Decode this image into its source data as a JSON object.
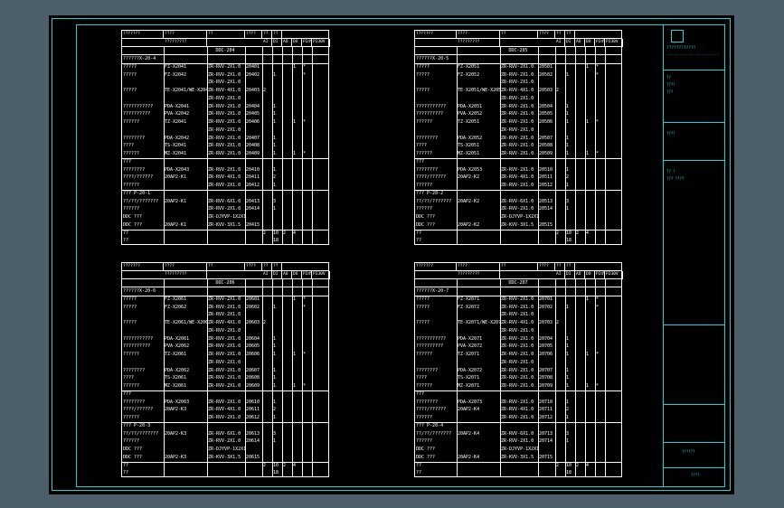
{
  "header": {
    "h0": "???????",
    "h1": "????",
    "h1b": "?????????",
    "h2": "??",
    "h3": "????",
    "h4": "??",
    "h5": "??",
    "io": [
      "AI",
      "DI",
      "AO",
      "DO",
      "P24V",
      "P230V"
    ]
  },
  "tables": [
    {
      "ddc": "DDC-204",
      "rows": [
        [
          "??????X-20-4",
          "",
          "",
          "",
          "",
          "",
          "",
          "",
          ""
        ],
        [
          "?????",
          "FZ-X2041",
          "ZR-RVV-2X1.0",
          "20401",
          "",
          "",
          "",
          "1",
          "*"
        ],
        [
          "?????",
          "FZ-X2042",
          "ZR-RVV-2X1.0",
          "20402",
          "",
          "1",
          "",
          "",
          "*"
        ],
        [
          "",
          "",
          "ZR-RVV-2X1.0",
          "",
          "",
          "",
          "",
          "",
          ""
        ],
        [
          "?????",
          "TE-X2041/WE-X2041",
          "ZR-RVV-4X1.0",
          "20403",
          "2",
          "",
          "",
          "",
          ""
        ],
        [
          "",
          "",
          "ZR-RVV-2X1.0",
          "",
          "",
          "",
          "",
          "",
          ""
        ],
        [
          "???????????",
          "PDA-X2041",
          "ZR-RVV-2X1.0",
          "20404",
          "",
          "1",
          "",
          "",
          ""
        ],
        [
          "??????????",
          "PVA-X2042",
          "ZR-RVV-2X1.0",
          "20405",
          "",
          "1",
          "",
          "",
          ""
        ],
        [
          "??????",
          "TZ-X2041",
          "ZR-RVV-2X1.0",
          "20406",
          "",
          "1",
          "",
          "1",
          "*"
        ],
        [
          "",
          "",
          "ZR-RVV-2X1.0",
          "",
          "",
          "",
          "",
          "",
          ""
        ],
        [
          "????????",
          "PDA-X2042",
          "ZR-RVV-2X1.0",
          "20407",
          "",
          "1",
          "",
          "",
          ""
        ],
        [
          "????",
          "TS-X2041",
          "ZR-RVV-2X1.0",
          "20408",
          "",
          "1",
          "",
          "",
          ""
        ],
        [
          "??????",
          "MZ-X2041",
          "ZR-RVV-2X1.0",
          "20409",
          "",
          "1",
          "",
          "1",
          "*"
        ],
        [
          "???",
          "",
          "",
          "",
          "",
          "",
          "",
          "",
          ""
        ],
        [
          "????????",
          "PDA-X2043",
          "ZR-RVV-2X1.0",
          "20410",
          "",
          "1",
          "",
          "",
          ""
        ],
        [
          "????/??????",
          "20AP2-K1",
          "ZR-RVV-4X1.0",
          "20411",
          "",
          "2",
          "",
          "",
          ""
        ],
        [
          "??????",
          "",
          "ZR-RVV-2X1.0",
          "20412",
          "",
          "1",
          "",
          "",
          ""
        ],
        [
          "??? P-20-1",
          "",
          "",
          "",
          "",
          "",
          "",
          "",
          ""
        ],
        [
          "??/??/???????",
          "20AP2-K1",
          "ZR-RVV-6X1.0",
          "20413",
          "",
          "3",
          "",
          "",
          ""
        ],
        [
          "??????",
          "",
          "ZR-RVV-2X1.0",
          "20414",
          "",
          "1",
          "",
          "",
          ""
        ],
        [
          "DDC ???",
          "",
          "ZR-DJYVP-1X2X1.0",
          "",
          "",
          "",
          "",
          "",
          ""
        ],
        [
          "DDC ???",
          "20AP2-K1",
          "ZR-KVV-3X1.5",
          "20415",
          "",
          "",
          "",
          "",
          ""
        ],
        [
          "??",
          "",
          "",
          "",
          "2",
          "10",
          "2",
          "4",
          ""
        ],
        [
          "??",
          "",
          "",
          "",
          "",
          "18",
          "",
          "",
          ""
        ]
      ]
    },
    {
      "ddc": "DDC-205",
      "rows": [
        [
          "??????X-20-5",
          "",
          "",
          "",
          "",
          "",
          "",
          "",
          ""
        ],
        [
          "?????",
          "FZ-X2051",
          "ZR-RVV-2X1.0",
          "20501",
          "",
          "",
          "",
          "1",
          "*"
        ],
        [
          "?????",
          "FZ-X2052",
          "ZR-RVV-2X1.0",
          "20502",
          "",
          "1",
          "",
          "",
          "*"
        ],
        [
          "",
          "",
          "ZR-RVV-2X1.0",
          "",
          "",
          "",
          "",
          "",
          ""
        ],
        [
          "?????",
          "TE-X2051/WE-X2051",
          "ZR-RVV-4X1.0",
          "20503",
          "2",
          "",
          "",
          "",
          ""
        ],
        [
          "",
          "",
          "ZR-RVV-2X1.0",
          "",
          "",
          "",
          "",
          "",
          ""
        ],
        [
          "???????????",
          "PDA-X2051",
          "ZR-RVV-2X1.0",
          "20504",
          "",
          "1",
          "",
          "",
          ""
        ],
        [
          "??????????",
          "PVA-X2052",
          "ZR-RVV-2X1.0",
          "20505",
          "",
          "1",
          "",
          "",
          ""
        ],
        [
          "??????",
          "TZ-X2051",
          "ZR-RVV-2X1.0",
          "20506",
          "",
          "1",
          "",
          "1",
          "*"
        ],
        [
          "",
          "",
          "ZR-RVV-2X1.0",
          "",
          "",
          "",
          "",
          "",
          ""
        ],
        [
          "????????",
          "PDA-X2052",
          "ZR-RVV-2X1.0",
          "20507",
          "",
          "1",
          "",
          "",
          ""
        ],
        [
          "????",
          "TS-X2051",
          "ZR-RVV-2X1.0",
          "20508",
          "",
          "1",
          "",
          "",
          ""
        ],
        [
          "??????",
          "MZ-X2051",
          "ZR-RVV-2X1.0",
          "20509",
          "",
          "1",
          "",
          "1",
          "*"
        ],
        [
          "???",
          "",
          "",
          "",
          "",
          "",
          "",
          "",
          ""
        ],
        [
          "????????",
          "PDA-X2053",
          "ZR-RVV-2X1.0",
          "20510",
          "",
          "1",
          "",
          "",
          ""
        ],
        [
          "????/??????",
          "20AP2-K2",
          "ZR-RVV-4X1.0",
          "20511",
          "",
          "2",
          "",
          "",
          ""
        ],
        [
          "??????",
          "",
          "ZR-RVV-2X1.0",
          "20512",
          "",
          "1",
          "",
          "",
          ""
        ],
        [
          "??? P-20-2",
          "",
          "",
          "",
          "",
          "",
          "",
          "",
          ""
        ],
        [
          "??/??/???????",
          "20AP2-K2",
          "ZR-RVV-6X1.0",
          "20513",
          "",
          "3",
          "",
          "",
          ""
        ],
        [
          "??????",
          "",
          "ZR-RVV-2X1.0",
          "20514",
          "",
          "1",
          "",
          "",
          ""
        ],
        [
          "DDC ???",
          "",
          "ZR-DJYVP-1X2X1.0",
          "",
          "",
          "",
          "",
          "",
          ""
        ],
        [
          "DDC ???",
          "20AP2-K2",
          "ZR-KVV-3X1.5",
          "20515",
          "",
          "",
          "",
          "",
          ""
        ],
        [
          "??",
          "",
          "",
          "",
          "2",
          "10",
          "2",
          "4",
          ""
        ],
        [
          "??",
          "",
          "",
          "",
          "",
          "18",
          "",
          "",
          ""
        ]
      ]
    },
    {
      "ddc": "DDC-206",
      "rows": [
        [
          "??????X-20-6",
          "",
          "",
          "",
          "",
          "",
          "",
          "",
          ""
        ],
        [
          "?????",
          "FZ-X2061",
          "ZR-RVV-2X1.0",
          "20601",
          "",
          "",
          "",
          "1",
          "*"
        ],
        [
          "?????",
          "FZ-X2062",
          "ZR-RVV-2X1.0",
          "20602",
          "",
          "1",
          "",
          "",
          "*"
        ],
        [
          "",
          "",
          "ZR-RVV-2X1.0",
          "",
          "",
          "",
          "",
          "",
          ""
        ],
        [
          "?????",
          "TE-X2061/WE-X2061",
          "ZR-RVV-4X1.0",
          "20603",
          "2",
          "",
          "",
          "",
          ""
        ],
        [
          "",
          "",
          "ZR-RVV-2X1.0",
          "",
          "",
          "",
          "",
          "",
          ""
        ],
        [
          "???????????",
          "PDA-X2061",
          "ZR-RVV-2X1.0",
          "20604",
          "",
          "1",
          "",
          "",
          ""
        ],
        [
          "??????????",
          "PVA-X2062",
          "ZR-RVV-2X1.0",
          "20605",
          "",
          "1",
          "",
          "",
          ""
        ],
        [
          "??????",
          "TZ-X2061",
          "ZR-RVV-2X1.0",
          "20606",
          "",
          "1",
          "",
          "1",
          "*"
        ],
        [
          "",
          "",
          "ZR-RVV-2X1.0",
          "",
          "",
          "",
          "",
          "",
          ""
        ],
        [
          "????????",
          "PDA-X2062",
          "ZR-RVV-2X1.0",
          "20607",
          "",
          "1",
          "",
          "",
          ""
        ],
        [
          "????",
          "TS-X2061",
          "ZR-RVV-2X1.0",
          "20608",
          "",
          "1",
          "",
          "",
          ""
        ],
        [
          "??????",
          "MZ-X2061",
          "ZR-RVV-2X1.0",
          "20609",
          "",
          "1",
          "",
          "1",
          "*"
        ],
        [
          "???",
          "",
          "",
          "",
          "",
          "",
          "",
          "",
          ""
        ],
        [
          "????????",
          "PDA-X2063",
          "ZR-RVV-2X1.0",
          "20610",
          "",
          "1",
          "",
          "",
          ""
        ],
        [
          "????/??????",
          "20AP2-K3",
          "ZR-RVV-4X1.0",
          "20611",
          "",
          "2",
          "",
          "",
          ""
        ],
        [
          "??????",
          "",
          "ZR-RVV-2X1.0",
          "20612",
          "",
          "1",
          "",
          "",
          ""
        ],
        [
          "??? P-20-3",
          "",
          "",
          "",
          "",
          "",
          "",
          "",
          ""
        ],
        [
          "??/??/???????",
          "20AP2-K3",
          "ZR-RVV-6X1.0",
          "20613",
          "",
          "3",
          "",
          "",
          ""
        ],
        [
          "??????",
          "",
          "ZR-RVV-2X1.0",
          "20614",
          "",
          "1",
          "",
          "",
          ""
        ],
        [
          "DDC ???",
          "",
          "ZR-DJYVP-1X2X1.0",
          "",
          "",
          "",
          "",
          "",
          ""
        ],
        [
          "DDC ???",
          "20AP2-K3",
          "ZR-KVV-3X1.5",
          "20615",
          "",
          "",
          "",
          "",
          ""
        ],
        [
          "??",
          "",
          "",
          "",
          "2",
          "10",
          "2",
          "4",
          ""
        ],
        [
          "??",
          "",
          "",
          "",
          "",
          "18",
          "",
          "",
          ""
        ]
      ]
    },
    {
      "ddc": "DDC-207",
      "rows": [
        [
          "??????X-20-7",
          "",
          "",
          "",
          "",
          "",
          "",
          "",
          ""
        ],
        [
          "?????",
          "FZ-X2071",
          "ZR-RVV-2X1.0",
          "20701",
          "",
          "",
          "",
          "1",
          "*"
        ],
        [
          "?????",
          "FZ-X2072",
          "ZR-RVV-2X1.0",
          "20702",
          "",
          "1",
          "",
          "",
          "*"
        ],
        [
          "",
          "",
          "ZR-RVV-2X1.0",
          "",
          "",
          "",
          "",
          "",
          ""
        ],
        [
          "?????",
          "TE-X2071/WE-X2071",
          "ZR-RVV-4X1.0",
          "20703",
          "2",
          "",
          "",
          "",
          ""
        ],
        [
          "",
          "",
          "ZR-RVV-2X1.0",
          "",
          "",
          "",
          "",
          "",
          ""
        ],
        [
          "???????????",
          "PDA-X2071",
          "ZR-RVV-2X1.0",
          "20704",
          "",
          "1",
          "",
          "",
          ""
        ],
        [
          "??????????",
          "PVA-X2072",
          "ZR-RVV-2X1.0",
          "20705",
          "",
          "1",
          "",
          "",
          ""
        ],
        [
          "??????",
          "TZ-X2071",
          "ZR-RVV-2X1.0",
          "20706",
          "",
          "1",
          "",
          "1",
          "*"
        ],
        [
          "",
          "",
          "ZR-RVV-2X1.0",
          "",
          "",
          "",
          "",
          "",
          ""
        ],
        [
          "????????",
          "PDA-X2072",
          "ZR-RVV-2X1.0",
          "20707",
          "",
          "1",
          "",
          "",
          ""
        ],
        [
          "????",
          "TS-X2071",
          "ZR-RVV-2X1.0",
          "20708",
          "",
          "1",
          "",
          "",
          ""
        ],
        [
          "??????",
          "MZ-X2071",
          "ZR-RVV-2X1.0",
          "20709",
          "",
          "1",
          "",
          "1",
          "*"
        ],
        [
          "???",
          "",
          "",
          "",
          "",
          "",
          "",
          "",
          ""
        ],
        [
          "????????",
          "PDA-X2073",
          "ZR-RVV-2X1.0",
          "20710",
          "",
          "1",
          "",
          "",
          ""
        ],
        [
          "????/??????",
          "20AP2-K4",
          "ZR-RVV-4X1.0",
          "20711",
          "",
          "2",
          "",
          "",
          ""
        ],
        [
          "??????",
          "",
          "ZR-RVV-2X1.0",
          "20712",
          "",
          "1",
          "",
          "",
          ""
        ],
        [
          "??? P-20-4",
          "",
          "",
          "",
          "",
          "",
          "",
          "",
          ""
        ],
        [
          "??/??/???????",
          "20AP2-K4",
          "ZR-RVV-6X1.0",
          "20713",
          "",
          "3",
          "",
          "",
          ""
        ],
        [
          "??????",
          "",
          "ZR-RVV-2X1.0",
          "20714",
          "",
          "1",
          "",
          "",
          ""
        ],
        [
          "DDC ???",
          "",
          "ZR-DJYVP-1X2X1.0",
          "",
          "",
          "",
          "",
          "",
          ""
        ],
        [
          "DDC ???",
          "20AP2-K4",
          "ZR-KVV-3X1.5",
          "20715",
          "",
          "",
          "",
          "",
          ""
        ],
        [
          "??",
          "",
          "",
          "",
          "2",
          "10",
          "2",
          "4",
          ""
        ],
        [
          "??",
          "",
          "",
          "",
          "",
          "18",
          "",
          "",
          ""
        ]
      ]
    }
  ],
  "title_block": {
    "company": "????????????",
    "company_en": "........................",
    "lines": [
      "??",
      "????",
      "???",
      "????",
      "?? ?",
      "??? ????"
    ],
    "drawing_title": "??????",
    "drawing_no": "????"
  },
  "colors": {
    "frame": "#19d2d2",
    "table_line": "#ffffff",
    "background": "#000000",
    "viewport": "#4d5f6b"
  }
}
